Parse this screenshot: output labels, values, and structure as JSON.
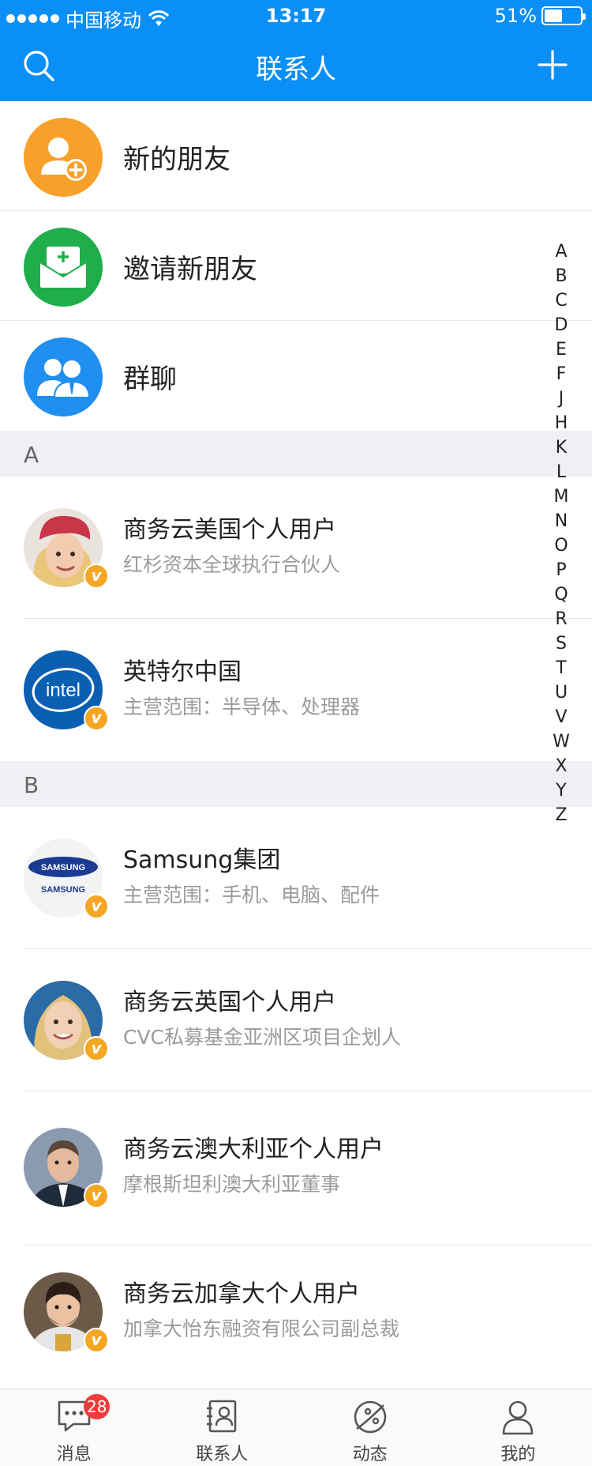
{
  "status_bar": {
    "carrier": "中国移动",
    "time": "13:17",
    "battery": "51%",
    "battery_level": 0.51
  },
  "nav": {
    "title": "联系人",
    "search_icon": "search-icon",
    "add_icon": "plus-icon"
  },
  "shortcuts": [
    {
      "label": "新的朋友",
      "icon": "add-friend-icon",
      "color": "#f7a12a"
    },
    {
      "label": "邀请新朋友",
      "icon": "invite-envelope-icon",
      "color": "#1fae4a"
    },
    {
      "label": "群聊",
      "icon": "group-chat-icon",
      "color": "#1f8ff0"
    }
  ],
  "sections": [
    {
      "letter": "A",
      "contacts": [
        {
          "name": "商务云美国个人用户",
          "subtitle": "红杉资本全球执行合伙人"
        },
        {
          "name": "英特尔中国",
          "subtitle": "主营范围：半导体、处理器"
        }
      ]
    },
    {
      "letter": "B",
      "contacts": [
        {
          "name": "Samsung集团",
          "subtitle": "主营范围：手机、电脑、配件"
        },
        {
          "name": "商务云英国个人用户",
          "subtitle": "CVC私募基金亚洲区项目企划人"
        },
        {
          "name": "商务云澳大利亚个人用户",
          "subtitle": "摩根斯坦利澳大利亚董事"
        },
        {
          "name": "商务云加拿大个人用户",
          "subtitle": "加拿大怡东融资有限公司副总裁"
        }
      ]
    }
  ],
  "logos": {
    "intel": "intel",
    "samsung": "SAMSUNG"
  },
  "verified_badge": "v",
  "alphabet": [
    "A",
    "B",
    "C",
    "D",
    "E",
    "F",
    "J",
    "H",
    "K",
    "L",
    "M",
    "N",
    "O",
    "P",
    "Q",
    "R",
    "S",
    "T",
    "U",
    "V",
    "W",
    "X",
    "Y",
    "Z"
  ],
  "tabs": [
    {
      "label": "消息",
      "icon": "message-icon",
      "badge": "28"
    },
    {
      "label": "联系人",
      "icon": "contacts-icon"
    },
    {
      "label": "动态",
      "icon": "discover-icon"
    },
    {
      "label": "我的",
      "icon": "profile-icon"
    }
  ],
  "colors": {
    "header": "#0a8ff6",
    "badge": "#f23b3b",
    "verified": "#f5a623"
  }
}
